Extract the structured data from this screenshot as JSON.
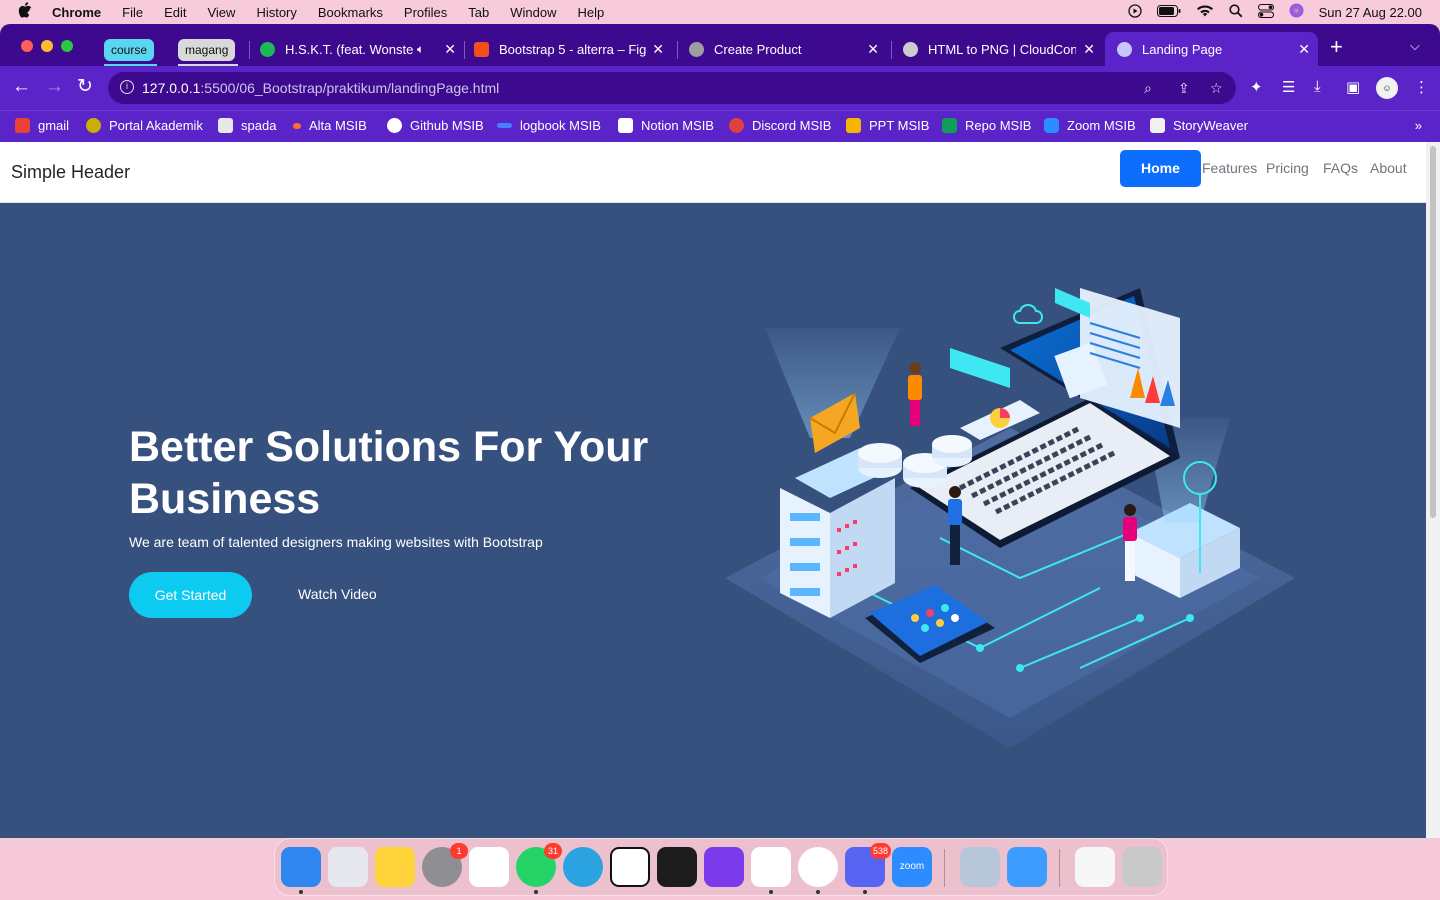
{
  "menubar": {
    "apple_icon": "apple-logo",
    "items": [
      "Chrome",
      "File",
      "Edit",
      "View",
      "History",
      "Bookmarks",
      "Profiles",
      "Tab",
      "Window",
      "Help"
    ],
    "clock": "Sun 27 Aug  22.00",
    "status_icons": [
      "play-icon",
      "battery-icon",
      "wifi-icon",
      "search-icon",
      "control-center-icon",
      "siri-icon"
    ]
  },
  "tab_groups": [
    {
      "label": "course",
      "color": "#5bd6f0"
    },
    {
      "label": "magang",
      "color": "#d9d9d9"
    }
  ],
  "tabs": [
    {
      "title": "H.S.K.T. (feat. Wonste",
      "icon": "spotify-icon",
      "fav_color": "#1db954",
      "audio": true
    },
    {
      "title": "Bootstrap 5 - alterra – Fig",
      "icon": "figma-icon",
      "fav_color": "#f24e1e"
    },
    {
      "title": "Create Product",
      "icon": "globe-icon",
      "fav_color": "#9e9e9e"
    },
    {
      "title": "HTML to PNG | CloudConv",
      "icon": "cloudconvert-icon",
      "fav_color": "#cccccc"
    },
    {
      "title": "Landing Page",
      "icon": "globe-icon",
      "fav_color": "#c7c7ff",
      "active": true
    }
  ],
  "toolbar": {
    "url_host": "127.0.0.1",
    "url_path": ":5500/06_Bootstrap/praktikum/landingPage.html"
  },
  "bookmarks": [
    {
      "label": "gmail",
      "color": "#ea4335"
    },
    {
      "label": "Portal Akademik",
      "color": "#c9b000"
    },
    {
      "label": "spada",
      "color": "#e8e8e8"
    },
    {
      "label": "Alta MSIB",
      "color": "#ff6b35"
    },
    {
      "label": "Github MSIB",
      "color": "#ffffff"
    },
    {
      "label": "logbook MSIB",
      "color": "#4a7cff"
    },
    {
      "label": "Notion MSIB",
      "color": "#ffffff"
    },
    {
      "label": "Discord MSIB",
      "color": "#e04040"
    },
    {
      "label": "PPT MSIB",
      "color": "#f4b400"
    },
    {
      "label": "Repo MSIB",
      "color": "#0f9d58"
    },
    {
      "label": "Zoom MSIB",
      "color": "#2d8cff"
    },
    {
      "label": "StoryWeaver",
      "color": "#f0f0f0"
    }
  ],
  "site": {
    "brand": "Simple Header",
    "nav": [
      "Home",
      "Features",
      "Pricing",
      "FAQs",
      "About"
    ],
    "hero_title": "Better Solutions For Your Business",
    "hero_subtitle": "We are team of talented designers making websites with Bootstrap",
    "cta_primary": "Get Started",
    "cta_secondary": "Watch Video",
    "hero_bg": "#37517e",
    "cta_color": "#0dcaf0",
    "nav_active_color": "#0d6efd"
  },
  "dock": [
    {
      "name": "finder-icon",
      "color": "#2f86ef",
      "dot": true
    },
    {
      "name": "launchpad-icon",
      "color": "#e7e7ef"
    },
    {
      "name": "notes-icon",
      "color": "#ffd43b"
    },
    {
      "name": "system-settings-icon",
      "color": "#8e8e93",
      "badge": "1"
    },
    {
      "name": "slack-icon",
      "color": "#ffffff"
    },
    {
      "name": "whatsapp-icon",
      "color": "#25d366",
      "badge": "31",
      "dot": true
    },
    {
      "name": "telegram-icon",
      "color": "#2aa3e0"
    },
    {
      "name": "notion-icon",
      "color": "#ffffff"
    },
    {
      "name": "terminal-icon",
      "color": "#1c1c1c"
    },
    {
      "name": "github-desktop-icon",
      "color": "#7c3aed"
    },
    {
      "name": "vscode-icon",
      "color": "#ffffff",
      "dot": true
    },
    {
      "name": "chrome-icon",
      "color": "#ffffff",
      "dot": true
    },
    {
      "name": "discord-icon",
      "color": "#5865f2",
      "badge": "538",
      "dot": true
    },
    {
      "name": "zoom-icon",
      "color": "#2d8cff"
    },
    {
      "name": "preview-icon",
      "color": "#b7c7d9"
    },
    {
      "name": "mail-icon",
      "color": "#3f9cff"
    },
    {
      "name": "document-icon",
      "color": "#f7f7f7"
    },
    {
      "name": "trash-icon",
      "color": "#c9c9c9"
    }
  ],
  "dock_zoom_label": "zoom"
}
